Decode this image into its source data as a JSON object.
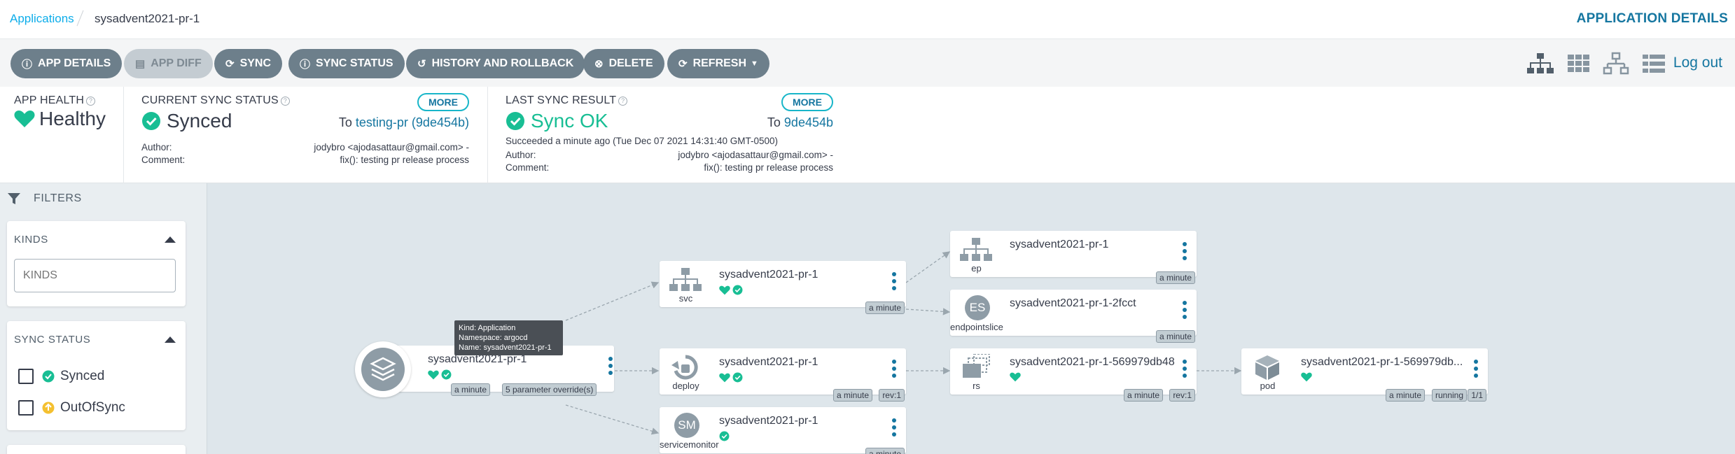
{
  "breadcrumb": {
    "root": "Applications",
    "current": "sysadvent2021-pr-1"
  },
  "page_title": "APPLICATION DETAILS",
  "toolbar": {
    "app_details": "APP DETAILS",
    "app_diff": "APP DIFF",
    "sync": "SYNC",
    "sync_status": "SYNC STATUS",
    "history": "HISTORY AND ROLLBACK",
    "delete": "DELETE",
    "refresh": "REFRESH",
    "logout": "Log out"
  },
  "app_health": {
    "label": "APP HEALTH",
    "value": "Healthy"
  },
  "current_sync": {
    "label": "CURRENT SYNC STATUS",
    "value": "Synced",
    "more": "MORE",
    "to_prefix": "To",
    "to_rev": "testing-pr (9de454b)",
    "author_label": "Author:",
    "author": "jodybro <ajodasattaur@gmail.com> -",
    "comment_label": "Comment:",
    "comment": "fix(): testing pr release process"
  },
  "last_sync": {
    "label": "LAST SYNC RESULT",
    "value": "Sync OK",
    "more": "MORE",
    "to_prefix": "To",
    "to_rev": "9de454b",
    "succeeded": "Succeeded a minute ago (Tue Dec 07 2021 14:31:40 GMT-0500)",
    "author_label": "Author:",
    "author": "jodybro <ajodasattaur@gmail.com> -",
    "comment_label": "Comment:",
    "comment": "fix(): testing pr release process"
  },
  "filters": {
    "title": "FILTERS",
    "kinds_title": "KINDS",
    "kinds_placeholder": "KINDS",
    "sync_status_title": "SYNC STATUS",
    "synced": "Synced",
    "out_of_sync": "OutOfSync"
  },
  "tooltip": {
    "kind": "Kind: Application",
    "namespace": "Namespace: argocd",
    "name": "Name: sysadvent2021-pr-1"
  },
  "nodes": {
    "app": {
      "name": "sysadvent2021-pr-1",
      "tag1": "a minute",
      "tag2": "5 parameter override(s)"
    },
    "svc": {
      "name": "sysadvent2021-pr-1",
      "kind": "svc",
      "tag1": "a minute"
    },
    "deploy": {
      "name": "sysadvent2021-pr-1",
      "kind": "deploy",
      "tag1": "a minute",
      "tag2": "rev:1"
    },
    "sm": {
      "name": "sysadvent2021-pr-1",
      "kind": "servicemonitor",
      "icon_text": "SM",
      "tag1": "a minute"
    },
    "ep": {
      "name": "sysadvent2021-pr-1",
      "kind": "ep",
      "tag1": "a minute"
    },
    "es": {
      "name": "sysadvent2021-pr-1-2fcct",
      "kind": "endpointslice",
      "icon_text": "ES",
      "tag1": "a minute"
    },
    "rs": {
      "name": "sysadvent2021-pr-1-569979db48",
      "kind": "rs",
      "tag1": "a minute",
      "tag2": "rev:1"
    },
    "pod": {
      "name": "sysadvent2021-pr-1-569979db...",
      "kind": "pod",
      "tag1": "a minute",
      "tag2": "running",
      "tag3": "1/1"
    }
  },
  "colors": {
    "healthy": "#18be94",
    "link": "#1576a0",
    "button": "#6d7f8b",
    "warning": "#f4c030"
  }
}
